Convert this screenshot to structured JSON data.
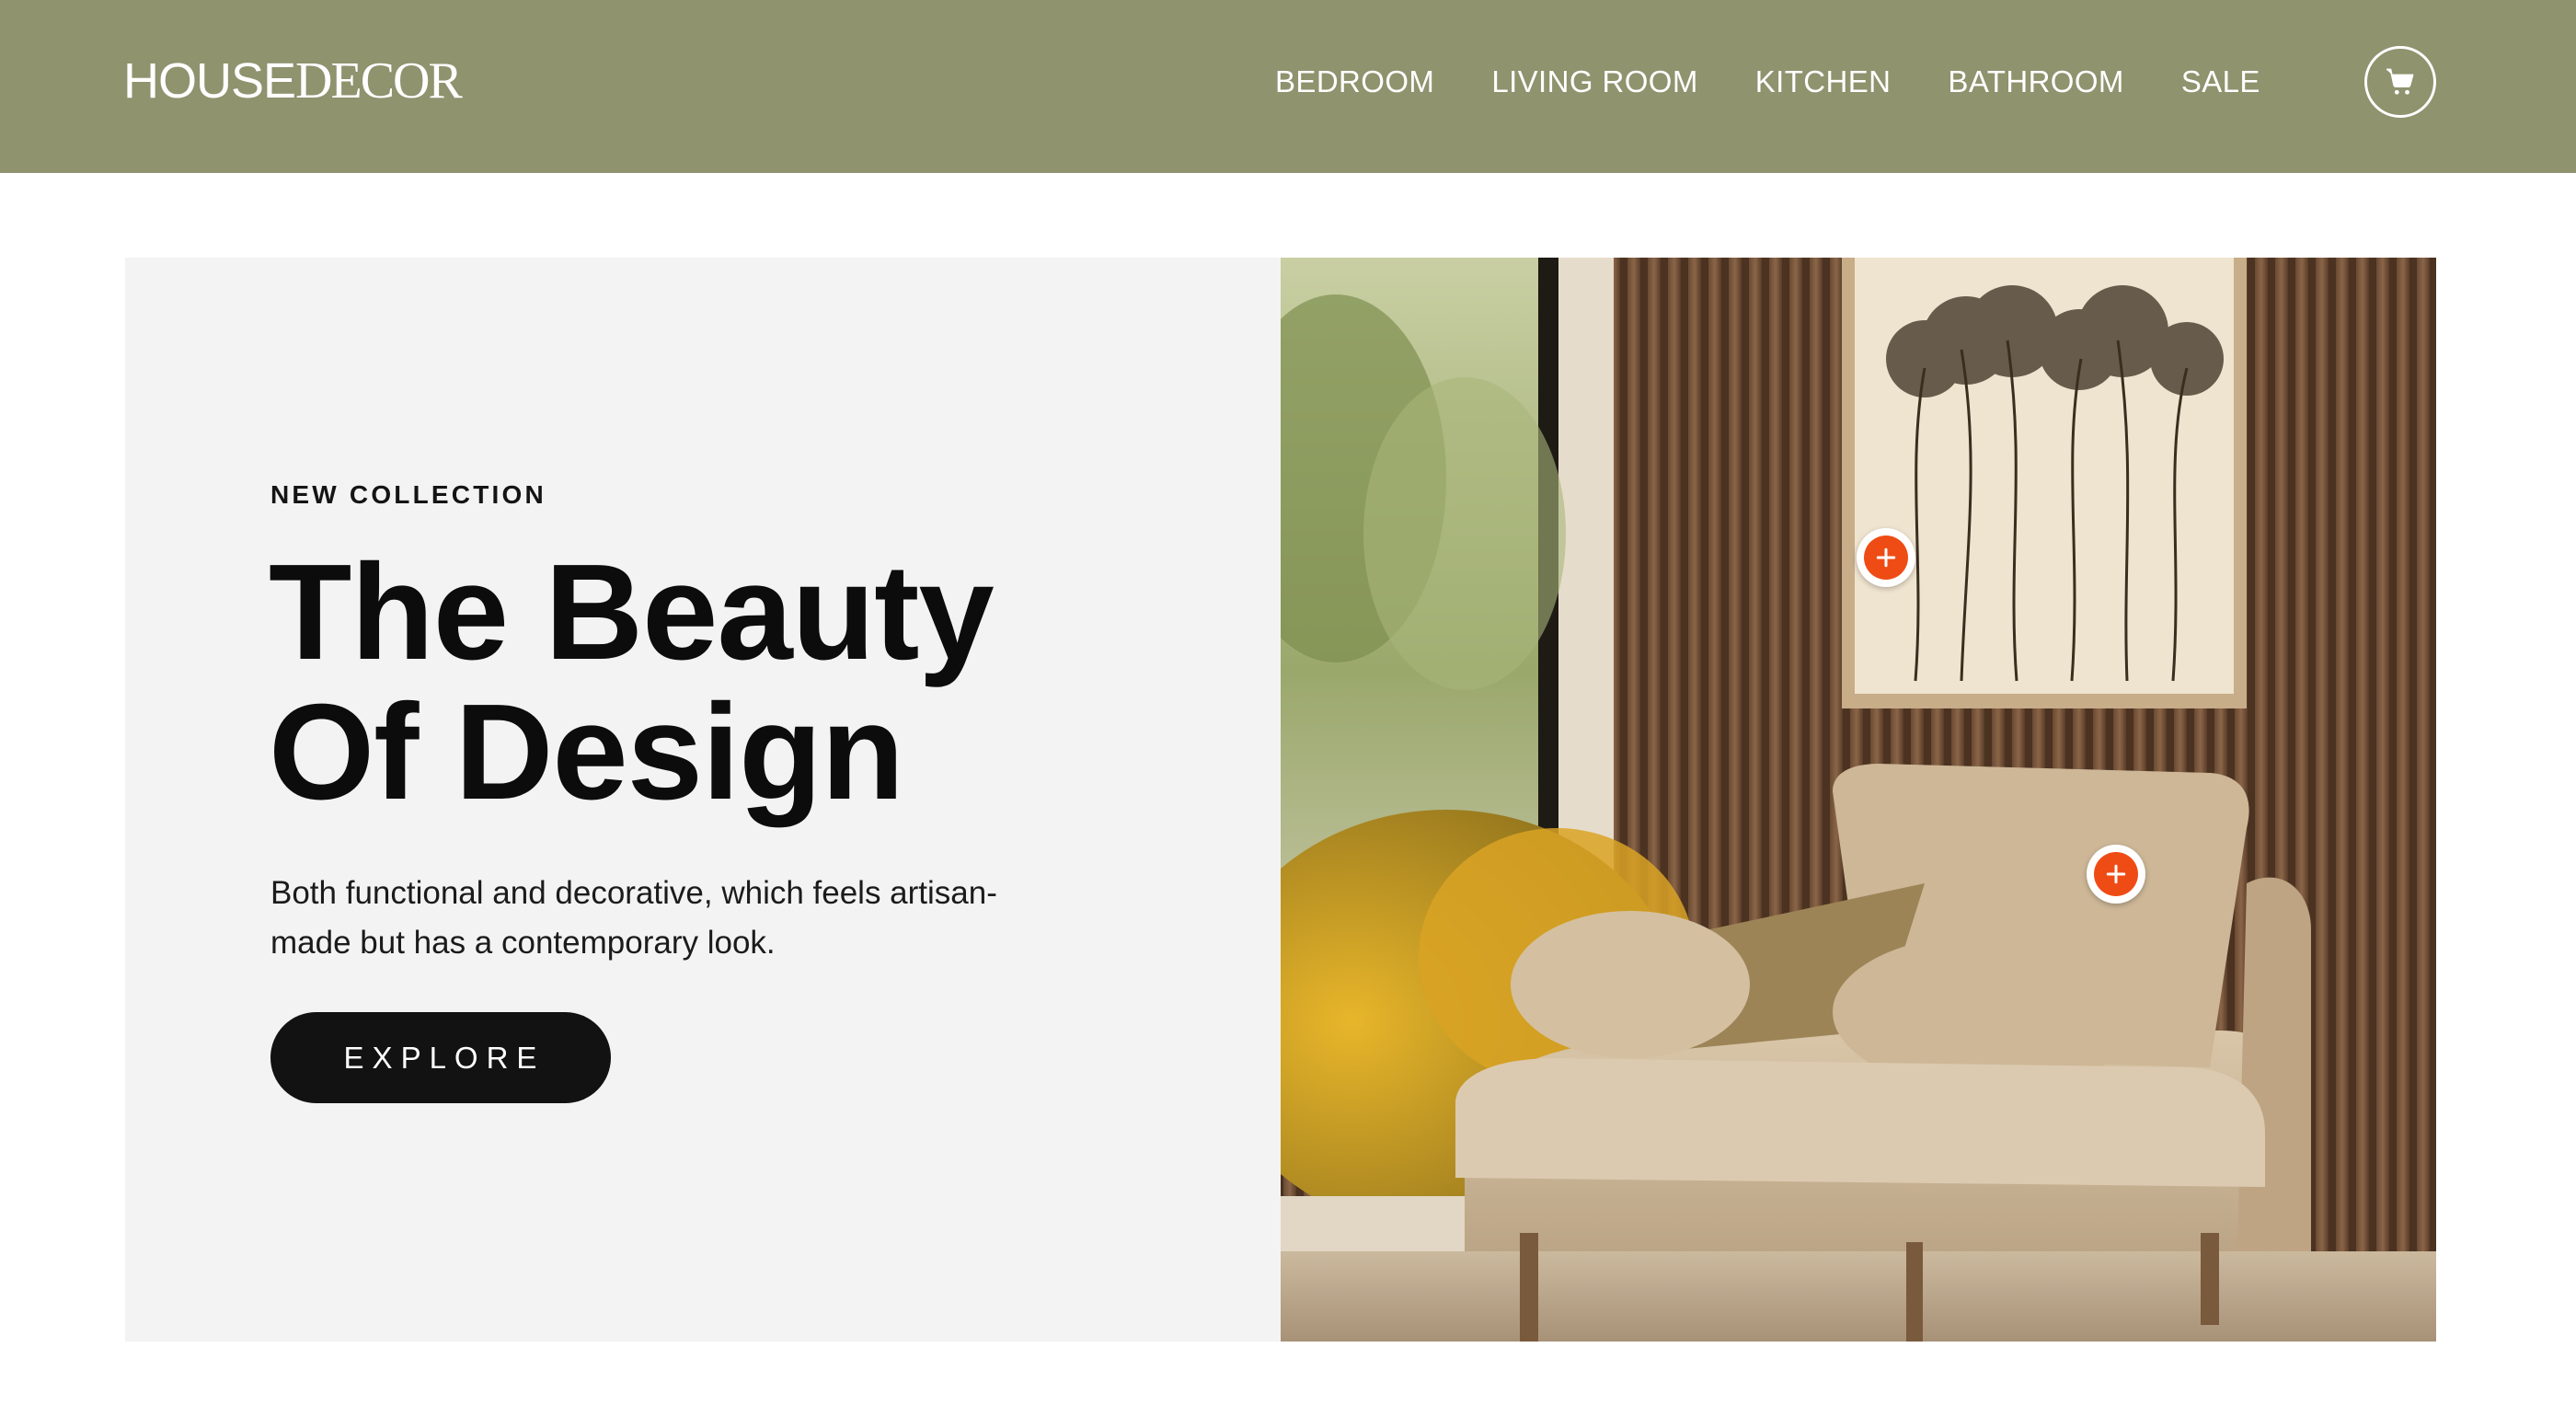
{
  "header": {
    "logo": {
      "part_bold": "HOUSE",
      "part_light": "DECOR"
    },
    "background_color": "#8f936e",
    "nav": [
      {
        "label": "BEDROOM"
      },
      {
        "label": "LIVING ROOM"
      },
      {
        "label": "KITCHEN"
      },
      {
        "label": "BATHROOM"
      },
      {
        "label": "SALE"
      }
    ],
    "cart": {
      "icon": "cart-icon"
    }
  },
  "hero": {
    "eyebrow": "NEW COLLECTION",
    "headline_line1": "The Beauty",
    "headline_line2": "Of Design",
    "description": "Both functional and decorative, which feels artisan-made but has a contemporary look.",
    "cta_label": "EXPLORE",
    "panel_color": "#f3f3f3",
    "cta_color": "#121212",
    "image": {
      "subject": "armchair-scene",
      "hotspots": [
        {
          "name": "hotspot-wall-art",
          "icon": "plus-icon"
        },
        {
          "name": "hotspot-armchair",
          "icon": "plus-icon"
        }
      ],
      "hotspot_color": "#ef4c15"
    }
  }
}
